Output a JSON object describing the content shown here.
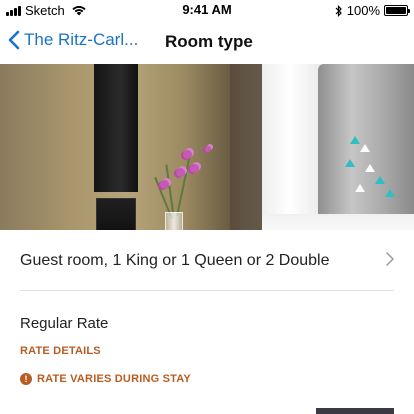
{
  "status_bar": {
    "carrier": "Sketch",
    "time": "9:41 AM",
    "battery": "100%",
    "battery_level": 1.0
  },
  "nav": {
    "back_label": "The Ritz-Carl...",
    "title": "Room type"
  },
  "hero": {
    "description_icon": "hotel-room-photo"
  },
  "room": {
    "label": "Guest room, 1 King or 1 Queen or 2 Double"
  },
  "rate": {
    "name": "Regular Rate",
    "details_link": "RATE DETAILS",
    "warning": "RATE VARIES DURING STAY",
    "warning_icon": "!"
  },
  "colors": {
    "accent_blue": "#1a73c9",
    "rate_orange": "#b75d22",
    "button_dark": "#3a3a44"
  }
}
